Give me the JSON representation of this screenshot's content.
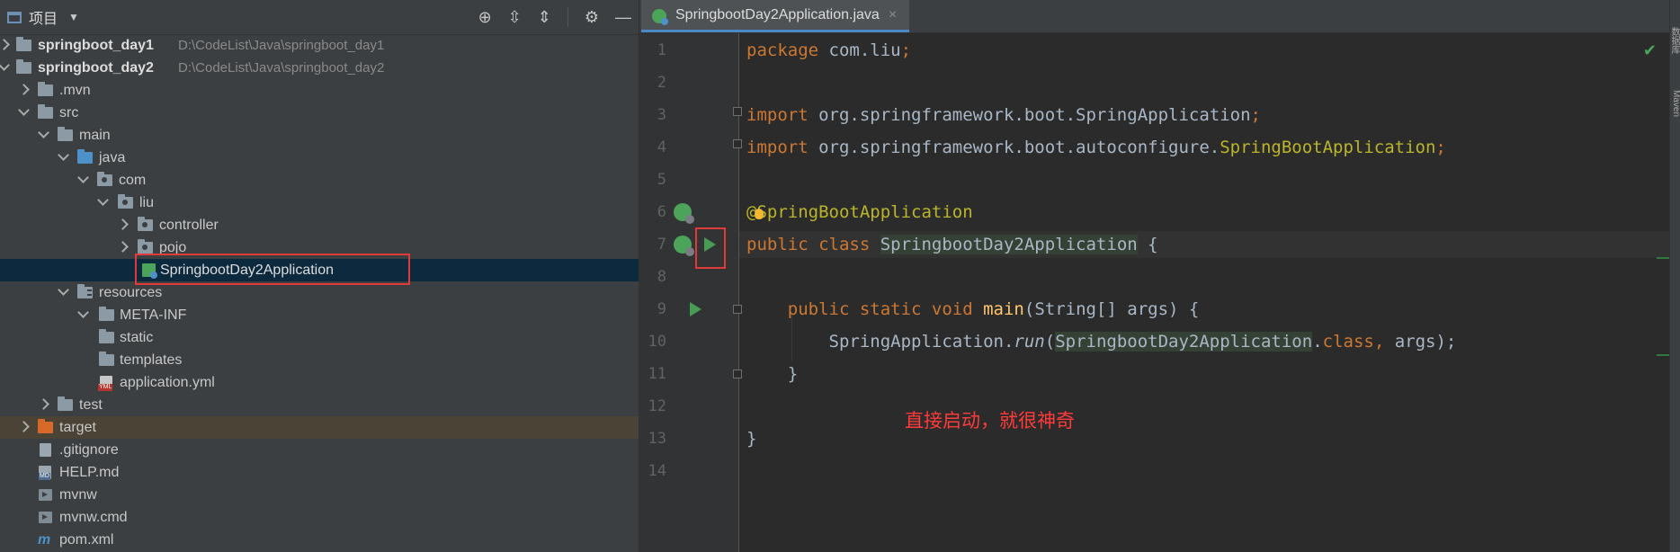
{
  "project_panel": {
    "title": "项目",
    "header_tools": [
      "locate-icon",
      "expand-all-icon",
      "collapse-all-icon",
      "gear-icon",
      "minimize-icon"
    ],
    "tree": [
      {
        "label": "springboot_day1",
        "path": "D:\\CodeList\\Java\\springboot_day1"
      },
      {
        "label": "springboot_day2",
        "path": "D:\\CodeList\\Java\\springboot_day2"
      },
      {
        "label": ".mvn"
      },
      {
        "label": "src"
      },
      {
        "label": "main"
      },
      {
        "label": "java"
      },
      {
        "label": "com"
      },
      {
        "label": "liu"
      },
      {
        "label": "controller"
      },
      {
        "label": "pojo"
      },
      {
        "label": "SpringbootDay2Application"
      },
      {
        "label": "resources"
      },
      {
        "label": "META-INF"
      },
      {
        "label": "static"
      },
      {
        "label": "templates"
      },
      {
        "label": "application.yml"
      },
      {
        "label": "test"
      },
      {
        "label": "target"
      },
      {
        "label": ".gitignore"
      },
      {
        "label": "HELP.md"
      },
      {
        "label": "mvnw"
      },
      {
        "label": "mvnw.cmd"
      },
      {
        "label": "pom.xml"
      }
    ]
  },
  "editor": {
    "tab_label": "SpringbootDay2Application.java",
    "line_numbers": [
      "1",
      "2",
      "3",
      "4",
      "5",
      "6",
      "7",
      "8",
      "9",
      "10",
      "11",
      "12",
      "13",
      "14"
    ],
    "code": {
      "l1_kw": "package",
      "l1_rest": " com.liu",
      "l1_semi": ";",
      "l3_kw": "import",
      "l3_rest": " org.springframework.boot.SpringApplication",
      "l3_semi": ";",
      "l4_kw": "import",
      "l4_rest": " org.springframework.boot.autoconfigure.",
      "l4_cls": "SpringBootApplication",
      "l4_semi": ";",
      "l6_ann": "@SpringBootApplication",
      "l7_kw": "public class ",
      "l7_cls": "SpringbootDay2Application",
      "l7_rest": " {",
      "l9_indent": "    ",
      "l9_kw": "public static void ",
      "l9_fn": "main",
      "l9_rest": "(String[] args) {",
      "l10_indent": "        ",
      "l10_a": "SpringApplication.",
      "l10_run": "run",
      "l10_p": "(",
      "l10_cls": "SpringbootDay2Application",
      "l10_dot": ".",
      "l10_kw": "class",
      "l10_comma": ",",
      "l10_rest": " args);",
      "l11": "    }",
      "l13": "}"
    },
    "annotation_note": "直接启动，就很神奇",
    "status_check": "✔"
  },
  "right_strip": {
    "labels": [
      "数据库",
      "Maven"
    ]
  }
}
